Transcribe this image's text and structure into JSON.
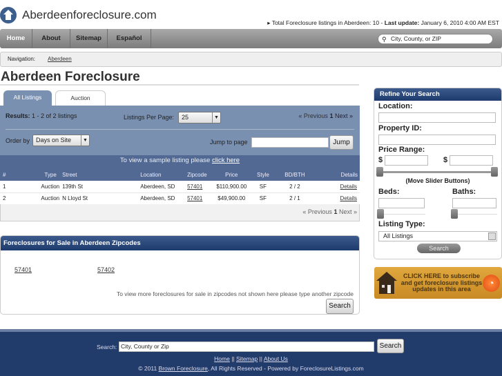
{
  "header": {
    "site_title": "Aberdeenforeclosure.com",
    "info_prefix": "Total Foreclosure listings in Aberdeen: 10 - ",
    "info_label": "Last update:",
    "info_value": " January 6, 2010 4:00 AM EST"
  },
  "nav": {
    "items": [
      "Home",
      "About",
      "Sitemap",
      "Español"
    ],
    "search_placeholder": "City, County, or ZIP"
  },
  "breadcrumb": {
    "label": "Navigation:",
    "item": "Aberdeen"
  },
  "page_title": "Aberdeen Foreclosure",
  "tabs": [
    "All Listings",
    "Auction"
  ],
  "results": {
    "label": "Results:",
    "value": " 1 - 2 of 2 listings",
    "per_page_label": "Listings Per Page:",
    "per_page": "25",
    "prev": "« Previous",
    "page": "1",
    "next": "Next »",
    "order_label": "Order by",
    "order_value": "Days on Site",
    "jump_label": "Jump to page",
    "jump_button": "Jump",
    "sample_text": "To view a sample listing please ",
    "sample_link": "click here"
  },
  "table": {
    "headers": [
      "#",
      "Type",
      "Street",
      "Location",
      "Zipcode",
      "Price",
      "Style",
      "BD/BTH",
      "Details"
    ],
    "rows": [
      [
        "1",
        "Auction",
        "139th St",
        "Aberdeen, SD",
        "57401",
        "$110,900.00",
        "SF",
        "2 / 2",
        "Details"
      ],
      [
        "2",
        "Auction",
        "N Lloyd St",
        "Aberdeen, SD",
        "57401",
        "$49,900.00",
        "SF",
        "2 / 1",
        "Details"
      ]
    ]
  },
  "zipcodes": {
    "title": "Foreclosures for Sale in Aberdeen Zipcodes",
    "items": [
      "57401",
      "57402"
    ],
    "note": "To view more foreclosures for sale in zipcodes not shown here please type another zipcode",
    "button": "Search"
  },
  "sidebar": {
    "title": "Refine Your Search",
    "location": "Location:",
    "property_id": "Property ID:",
    "price_range": "Price Range:",
    "currency": "$",
    "slider_hint": "(Move Slider Buttons)",
    "beds": "Beds:",
    "baths": "Baths:",
    "listing_type": "Listing Type:",
    "listing_type_value": "All Listings",
    "search": "Search"
  },
  "subscribe": {
    "text": "CLICK HERE to subscribe and get foreclosure listings updates in this area"
  },
  "footer": {
    "search_label": "Search:",
    "search_value": "City, County or Zip",
    "search_button": "Search",
    "links": [
      "Home",
      "Sitemap",
      "About Us"
    ],
    "sep": " || ",
    "copyright_prefix": "© 2011 ",
    "copyright_link": "Brown Foreclosure",
    "copyright_suffix": ", All Rights Reserved - Powered by ForeclosureListings.com"
  },
  "colors": {
    "panel": "#7a90b1",
    "band": "#526a93",
    "header_blue": "#1e3b6e",
    "footer": "#213b6b",
    "subscribe": "#d49a30"
  }
}
